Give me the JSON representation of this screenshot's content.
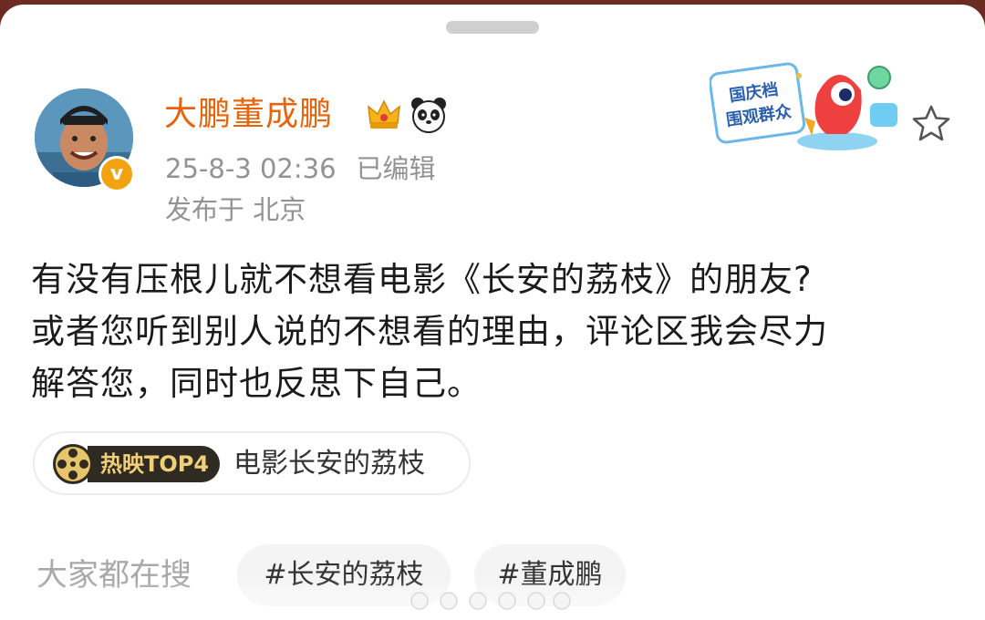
{
  "post": {
    "username": "大鹏董成鹏",
    "time": "25-8-3 02:36",
    "edited": "已编辑",
    "location": "发布于 北京",
    "holiday_badge_line1": "国庆档",
    "holiday_badge_line2": "围观群众",
    "body_lines": [
      "有没有压根儿就不想看电影《长安的荔枝》的朋友?",
      "或者您听到别人说的不想看的理由，评论区我会尽力",
      "解答您，同时也反思下自己。"
    ]
  },
  "movie_card": {
    "badge": "热映TOP4",
    "title": "电影长安的荔枝"
  },
  "search": {
    "label": "大家都在搜",
    "tags": [
      "#长安的荔枝",
      "#董成鹏"
    ]
  },
  "icons": {
    "verified": "verified-v-icon",
    "crown": "crown-icon",
    "panda": "panda-icon",
    "star": "star-outline-icon",
    "film": "film-reel-icon"
  },
  "colors": {
    "username": "#e8630a",
    "meta": "#939393",
    "verified": "#f2a30f",
    "hot_label_bg": "#2f2a22",
    "hot_label_text": "#f1cf76"
  }
}
